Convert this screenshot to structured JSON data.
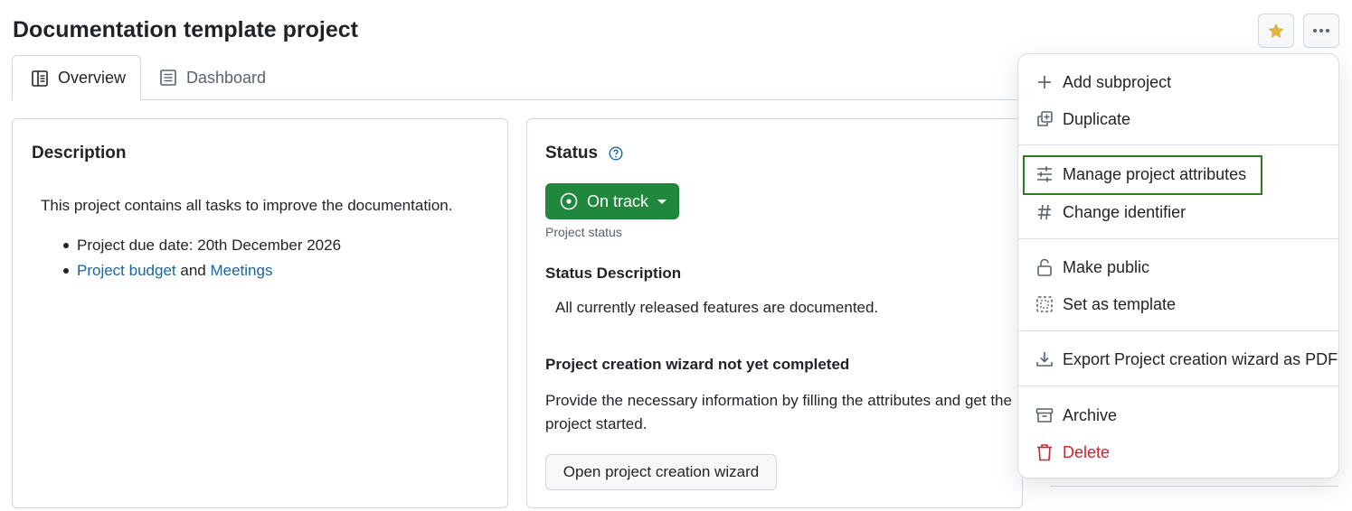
{
  "page": {
    "title": "Documentation template project"
  },
  "header": {
    "star_icon": "star-icon",
    "more_icon": "kebab-horizontal-icon",
    "star_color": "#e3b341"
  },
  "tabs": [
    {
      "label": "Overview",
      "icon": "book-icon",
      "active": true
    },
    {
      "label": "Dashboard",
      "icon": "list-icon",
      "active": false
    }
  ],
  "description": {
    "title": "Description",
    "text": "This project contains all tasks to improve the documentation.",
    "bullet_1": "Project due date: 20th December 2026",
    "bullet_2_link_1": "Project budget",
    "bullet_2_mid": "and",
    "bullet_2_link_2": "Meetings"
  },
  "status": {
    "title": "Status",
    "help_icon": "question-icon",
    "value": "On track",
    "caption": "Project status",
    "color": "#1f883d",
    "description_title": "Status Description",
    "description_text": "All currently released features are documented.",
    "wizard_title": "Project creation wizard not yet completed",
    "wizard_text": "Provide the necessary information by filling the attributes and get the project started.",
    "wizard_button": "Open project creation wizard"
  },
  "menu": {
    "items": [
      {
        "label": "Add subproject",
        "icon": "plus-icon"
      },
      {
        "label": "Duplicate",
        "icon": "duplicate-icon"
      },
      {
        "label": "Manage project attributes",
        "icon": "sliders-icon"
      },
      {
        "label": "Change identifier",
        "icon": "hash-icon"
      },
      {
        "label": "Make public",
        "icon": "unlock-icon"
      },
      {
        "label": "Set as template",
        "icon": "template-icon"
      },
      {
        "label": "Export Project creation wizard as PDF",
        "icon": "download-icon"
      },
      {
        "label": "Archive",
        "icon": "archive-icon"
      },
      {
        "label": "Delete",
        "icon": "trash-icon",
        "danger_color": "#cf222e"
      }
    ],
    "highlight_color": "#2d7a1f"
  }
}
